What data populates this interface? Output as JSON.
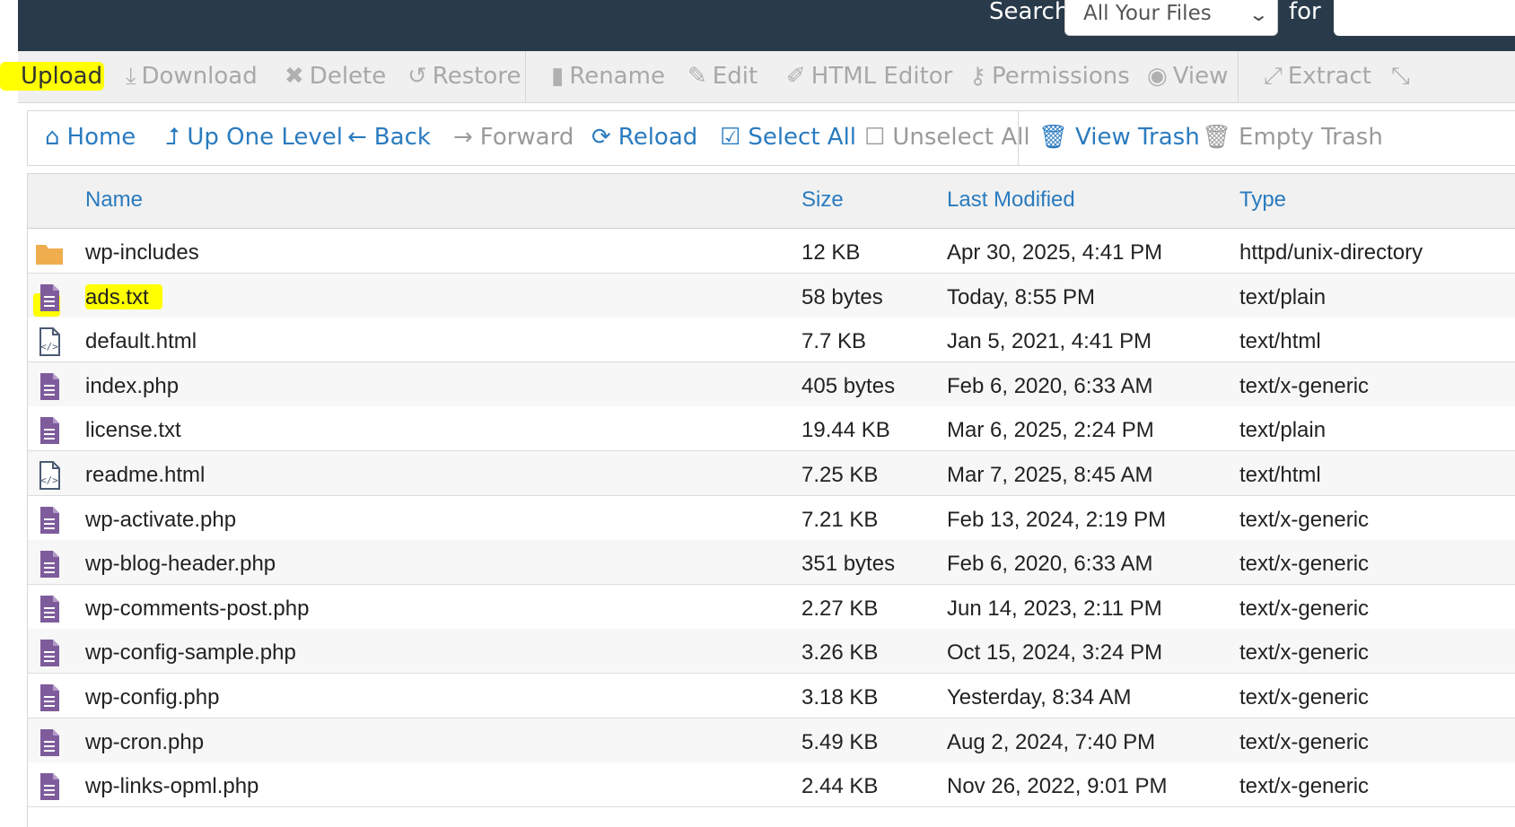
{
  "search": {
    "label": "Search",
    "scope_selected": "All Your Files",
    "for_label": "for",
    "query_value": ""
  },
  "actions": {
    "upload": "Upload",
    "download": "Download",
    "delete": "Delete",
    "restore": "Restore",
    "rename": "Rename",
    "edit": "Edit",
    "html_editor": "HTML Editor",
    "permissions": "Permissions",
    "view": "View",
    "extract": "Extract"
  },
  "nav": {
    "home": "Home",
    "up_one_level": "Up One Level",
    "back": "Back",
    "forward": "Forward",
    "reload": "Reload",
    "select_all": "Select All",
    "unselect_all": "Unselect All",
    "view_trash": "View Trash",
    "empty_trash": "Empty Trash"
  },
  "table": {
    "headers": {
      "name": "Name",
      "size": "Size",
      "modified": "Last Modified",
      "type": "Type"
    },
    "rows": [
      {
        "icon": "folder-icon",
        "name": "wp-includes",
        "size": "12 KB",
        "modified": "Apr 30, 2025, 4:41 PM",
        "type": "httpd/unix-directory"
      },
      {
        "icon": "text-file-icon",
        "name": "ads.txt",
        "size": "58 bytes",
        "modified": "Today, 8:55 PM",
        "type": "text/plain"
      },
      {
        "icon": "html-file-icon",
        "name": "default.html",
        "size": "7.7 KB",
        "modified": "Jan 5, 2021, 4:41 PM",
        "type": "text/html"
      },
      {
        "icon": "text-file-icon",
        "name": "index.php",
        "size": "405 bytes",
        "modified": "Feb 6, 2020, 6:33 AM",
        "type": "text/x-generic"
      },
      {
        "icon": "text-file-icon",
        "name": "license.txt",
        "size": "19.44 KB",
        "modified": "Mar 6, 2025, 2:24 PM",
        "type": "text/plain"
      },
      {
        "icon": "html-file-icon",
        "name": "readme.html",
        "size": "7.25 KB",
        "modified": "Mar 7, 2025, 8:45 AM",
        "type": "text/html"
      },
      {
        "icon": "text-file-icon",
        "name": "wp-activate.php",
        "size": "7.21 KB",
        "modified": "Feb 13, 2024, 2:19 PM",
        "type": "text/x-generic"
      },
      {
        "icon": "text-file-icon",
        "name": "wp-blog-header.php",
        "size": "351 bytes",
        "modified": "Feb 6, 2020, 6:33 AM",
        "type": "text/x-generic"
      },
      {
        "icon": "text-file-icon",
        "name": "wp-comments-post.php",
        "size": "2.27 KB",
        "modified": "Jun 14, 2023, 2:11 PM",
        "type": "text/x-generic"
      },
      {
        "icon": "text-file-icon",
        "name": "wp-config-sample.php",
        "size": "3.26 KB",
        "modified": "Oct 15, 2024, 3:24 PM",
        "type": "text/x-generic"
      },
      {
        "icon": "text-file-icon",
        "name": "wp-config.php",
        "size": "3.18 KB",
        "modified": "Yesterday, 8:34 AM",
        "type": "text/x-generic"
      },
      {
        "icon": "text-file-icon",
        "name": "wp-cron.php",
        "size": "5.49 KB",
        "modified": "Aug 2, 2024, 7:40 PM",
        "type": "text/x-generic"
      },
      {
        "icon": "text-file-icon",
        "name": "wp-links-opml.php",
        "size": "2.44 KB",
        "modified": "Nov 26, 2022, 9:01 PM",
        "type": "text/x-generic"
      }
    ]
  },
  "colors": {
    "topbar": "#293a4a",
    "link": "#2a7bbf",
    "folder": "#f0ad4e",
    "file_icon": "#7e5c9b",
    "highlight": "#ffff00"
  }
}
